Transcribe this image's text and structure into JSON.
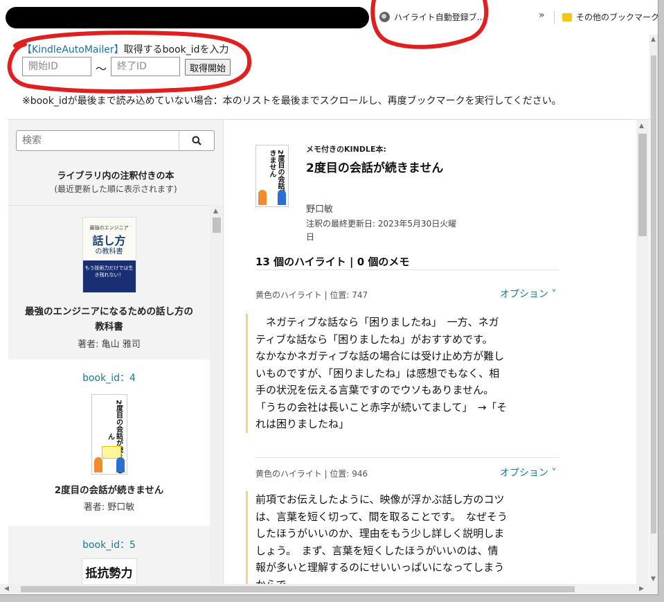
{
  "bookmarks": {
    "highlight_bookmark": "ハイライト自動登録ブ...",
    "more_chevron": "»",
    "other_bookmarks": "その他のブックマーク"
  },
  "tool": {
    "app_name": "【KindleAutoMailer】",
    "title_suffix": "取得するbook_idを入力",
    "start_placeholder": "開始ID",
    "tilde": "〜",
    "end_placeholder": "終了ID",
    "start_button": "取得開始",
    "note": "※book_idが最後まで読み込めていない場合：本のリストを最後までスクロールし、再度ブックマークを実行してください。"
  },
  "sidebar": {
    "search_placeholder": "検索",
    "heading": "ライブラリ内の注釈付きの本",
    "subheading": "(最近更新した順に表示されます)",
    "books": [
      {
        "cover_line1": "最強のエンジニア",
        "cover_line2": "話し方",
        "cover_line3": "の教科書",
        "cover_band": "もう技術力だけでは生き残れない！",
        "title": "最強のエンジニアになるための話し方の教科書",
        "author": "著者: 亀山 雅司"
      },
      {
        "id_label": "book_id：4",
        "cover_title": "2度目の会話が続きません",
        "title": "2度目の会話が続きません",
        "author": "著者: 野口敏"
      },
      {
        "id_label": "book_id：5",
        "cover_title": "抵抗勢力"
      }
    ]
  },
  "detail": {
    "kind": "メモ付きのKINDLE本:",
    "title": "2度目の会話が続きません",
    "author": "野口敏",
    "updated": "注釈の最終更新日:  2023年5月30日火曜日",
    "counts": "13 個のハイライト |  0 個のメモ",
    "highlights": [
      {
        "meta": "黄色のハイライト | 位置: 747",
        "option": "オプション ˅",
        "text": "　ネガティブな話なら「困りましたね」　一方、ネガティブな話なら「困りましたね」がおすすめです。　なかなかネガティブな話の場合には受け止め方が難しいものですが、「困りましたね」は感想でもなく、相手の状況を伝える言葉ですのでウソもありません。「うちの会社は長いこと赤字が続いてまして」　→「それは困りましたね」"
      },
      {
        "meta": "黄色のハイライト | 位置: 946",
        "option": "オプション ˅",
        "text": "前項でお伝えしたように、映像が浮かぶ話し方のコツは、言葉を短く切って、間を取ることです。　なぜそうしたほうがいいのか、理由をもう少し詳しく説明しましょう。　まず、言葉を短くしたほうがいいのは、情報が多いと理解するのにせいいっぱいになってしまうからで"
      }
    ]
  },
  "colors": {
    "accent": "#1a7a8f",
    "link": "#1a6fa8",
    "highlight_bar": "#f5d76e",
    "annotation_red": "#e02020"
  }
}
